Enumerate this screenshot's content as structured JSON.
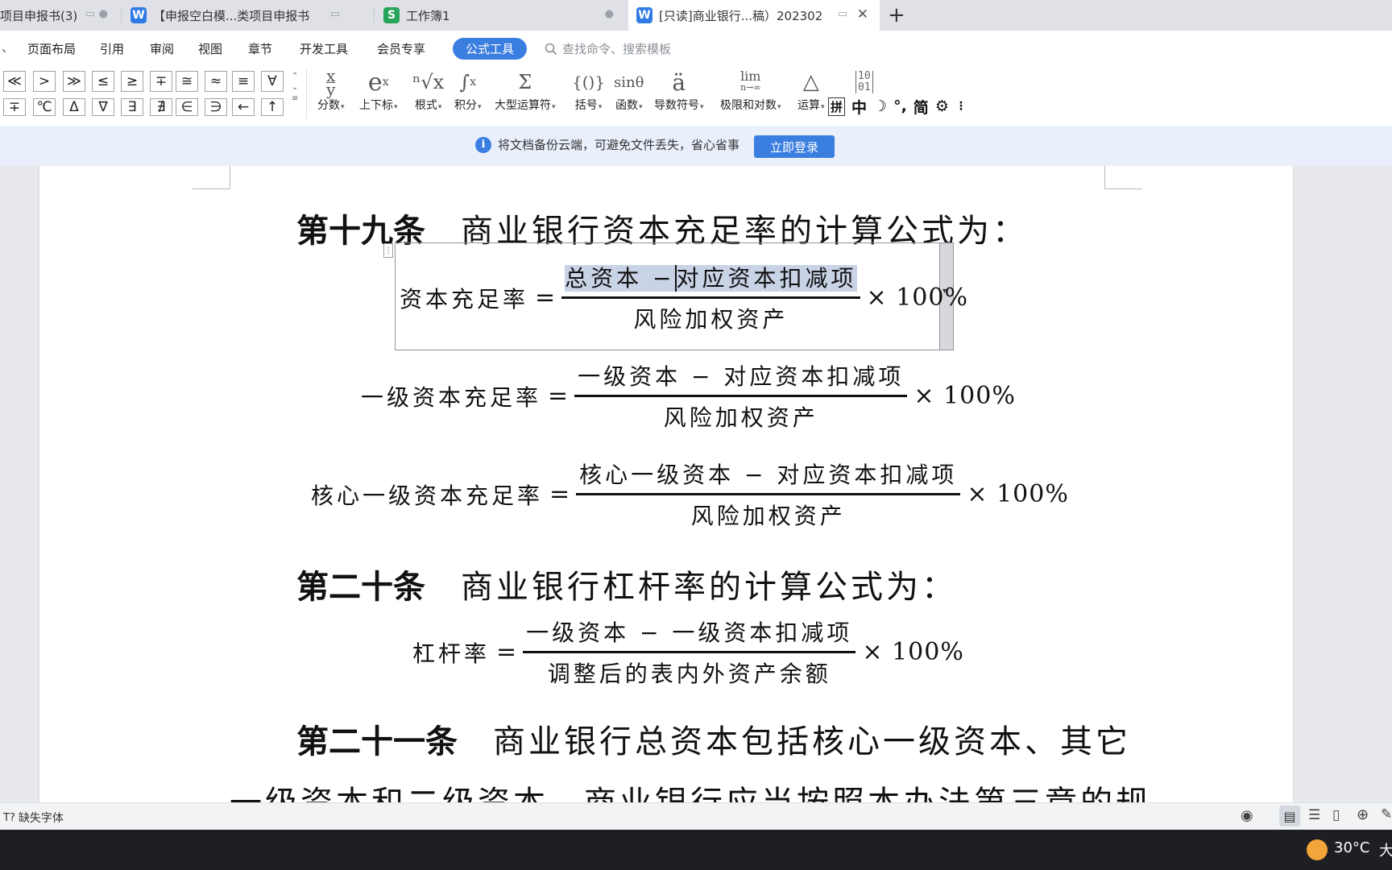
{
  "tabs": [
    {
      "label": "项目申报书(3)",
      "icon": "wps-writer-icon",
      "active": false
    },
    {
      "label": "【申报空白模...类项目申报书",
      "icon": "W",
      "active": false
    },
    {
      "label": "工作簿1",
      "icon": "S",
      "active": false
    },
    {
      "label": "[只读]商业银行...稿）202302",
      "icon": "W",
      "active": true
    }
  ],
  "new_tab": "+",
  "menu": {
    "items": [
      "页面布局",
      "引用",
      "审阅",
      "视图",
      "章节",
      "开发工具",
      "会员专享"
    ],
    "active_tab": "公式工具",
    "search_placeholder": "查找命令、搜索模板"
  },
  "ribbon": {
    "symbols_row1": [
      "≪",
      ">",
      "≫",
      "≤",
      "≥",
      "∓",
      "≅",
      "≈",
      "≡",
      "∀"
    ],
    "symbols_row2": [
      "∓",
      "℃",
      "Δ",
      "∇",
      "∃",
      "∄",
      "∈",
      "∋",
      "←",
      "↑"
    ],
    "buttons": [
      {
        "glyph": "x/y",
        "label": "分数"
      },
      {
        "glyph": "eˣ",
        "label": "上下标"
      },
      {
        "glyph": "ⁿ√x",
        "label": "根式"
      },
      {
        "glyph": "∫",
        "label": "积分"
      },
      {
        "glyph": "Σ",
        "label": "大型运算符"
      },
      {
        "glyph": "{()}",
        "label": "括号"
      },
      {
        "glyph": "sinθ",
        "label": "函数"
      },
      {
        "glyph": "ä",
        "label": "导数符号"
      },
      {
        "glyph": "lim",
        "label": "极限和对数"
      },
      {
        "glyph": "△",
        "label": "运算"
      }
    ],
    "ime": [
      "拼",
      "中",
      "简"
    ]
  },
  "notice": {
    "text": "将文档备份云端，可避免文件丢失，省心省事",
    "button": "立即登录"
  },
  "document": {
    "article19": {
      "number": "第十九条",
      "text": "商业银行资本充足率的计算公式为："
    },
    "formula1": {
      "lhs": "资本充足率",
      "num_a": "总资本 −",
      "num_b": "对应资本扣减项",
      "den": "风险加权资产",
      "mult": "× 100%"
    },
    "formula2": {
      "lhs": "一级资本充足率",
      "num": "一级资本 − 对应资本扣减项",
      "den": "风险加权资产",
      "mult": "× 100%"
    },
    "formula3": {
      "lhs": "核心一级资本充足率",
      "num": "核心一级资本 − 对应资本扣减项",
      "den": "风险加权资产",
      "mult": "× 100%"
    },
    "article20": {
      "number": "第二十条",
      "text": "商业银行杠杆率的计算公式为："
    },
    "formula4": {
      "lhs": "杠杆率",
      "num": "一级资本 − 一级资本扣减项",
      "den": "调整后的表内外资产余额",
      "mult": "× 100%"
    },
    "article21": {
      "number": "第二十一条",
      "text": "商业银行总资本包括核心一级资本、其它"
    },
    "line_next": "一级资本和二级资本。商业银行应当按照本办法第三章的规"
  },
  "status": {
    "missing_fonts": "缺失字体"
  },
  "weather": {
    "temp": "30°C",
    "extra": "大"
  },
  "colors": {
    "accent": "#3a7ee0",
    "wps_writer": "#2f7be5",
    "wps_sheet": "#27a35a"
  }
}
